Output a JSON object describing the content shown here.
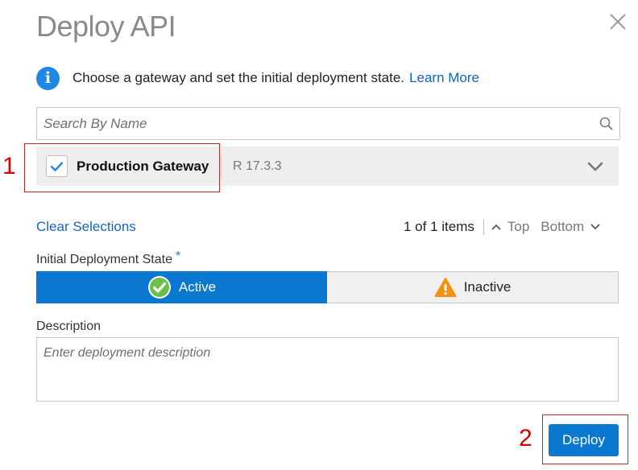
{
  "dialog": {
    "title": "Deploy API"
  },
  "info": {
    "text": "Choose a gateway and set the initial deployment state.",
    "link": "Learn More",
    "icon": "info-icon"
  },
  "search": {
    "placeholder": "Search By Name",
    "value": ""
  },
  "gateways": [
    {
      "name": "Production Gateway",
      "version": "R 17.3.3",
      "checked": true
    }
  ],
  "list_controls": {
    "clear": "Clear Selections",
    "count": "1 of 1 items",
    "top": "Top",
    "bottom": "Bottom"
  },
  "deployment_state": {
    "label": "Initial Deployment State",
    "required_mark": "*",
    "options": [
      {
        "label": "Active",
        "selected": true
      },
      {
        "label": "Inactive",
        "selected": false
      }
    ]
  },
  "description": {
    "label": "Description",
    "placeholder": "Enter deployment description",
    "value": ""
  },
  "footer": {
    "deploy": "Deploy"
  },
  "annotations": [
    {
      "label": "1"
    },
    {
      "label": "2"
    }
  ],
  "colors": {
    "accent": "#0a78d1",
    "link": "#1565c0",
    "annotation": "#d50000"
  }
}
